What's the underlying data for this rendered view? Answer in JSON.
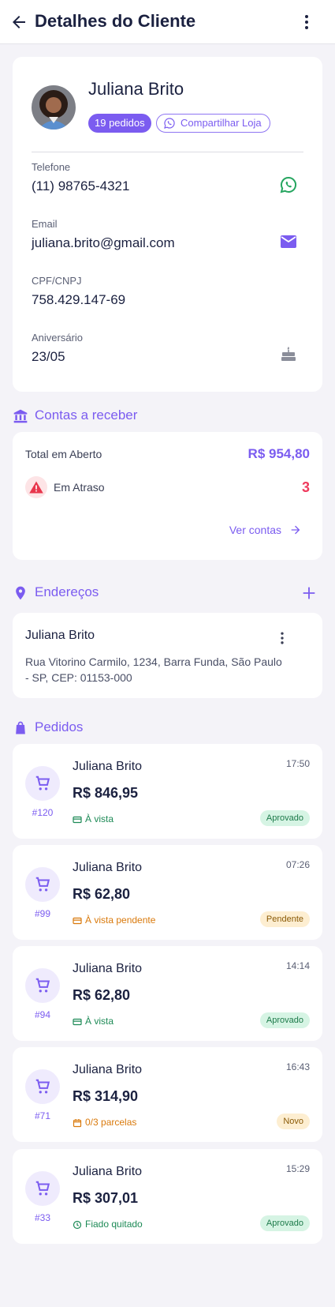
{
  "header": {
    "title": "Detalhes do Cliente",
    "back_icon": "arrow-left-icon",
    "menu_icon": "more-vertical-icon"
  },
  "profile": {
    "name": "Juliana Brito",
    "orders_badge": "19 pedidos",
    "share_label": "Compartilhar Loja",
    "phone_label": "Telefone",
    "phone_value": "(11) 98765-4321",
    "email_label": "Email",
    "email_value": "juliana.brito@gmail.com",
    "doc_label": "CPF/CNPJ",
    "doc_value": "758.429.147-69",
    "birthday_label": "Aniversário",
    "birthday_value": "23/05"
  },
  "receivables": {
    "title": "Contas a receber",
    "total_label": "Total em Aberto",
    "total_value": "R$ 954,80",
    "late_label": "Em Atraso",
    "late_count": "3",
    "link_label": "Ver contas"
  },
  "addresses": {
    "title": "Endereços",
    "items": [
      {
        "name": "Juliana Brito",
        "text": "Rua Vitorino Carmilo, 1234, Barra Funda, São Paulo - SP, CEP: 01153-000"
      }
    ]
  },
  "orders": {
    "title": "Pedidos",
    "items": [
      {
        "number": "#120",
        "name": "Juliana Brito",
        "time": "17:50",
        "total": "R$ 846,95",
        "payment": "À vista",
        "payment_icon": "credit-card-icon",
        "status": "Aprovado"
      },
      {
        "number": "#99",
        "name": "Juliana Brito",
        "time": "07:26",
        "total": "R$ 62,80",
        "payment": "À vista pendente",
        "payment_icon": "credit-card-icon",
        "status": "Pendente"
      },
      {
        "number": "#94",
        "name": "Juliana Brito",
        "time": "14:14",
        "total": "R$ 62,80",
        "payment": "À vista",
        "payment_icon": "credit-card-icon",
        "status": "Aprovado"
      },
      {
        "number": "#71",
        "name": "Juliana Brito",
        "time": "16:43",
        "total": "R$ 314,90",
        "payment": "0/3 parcelas",
        "payment_icon": "calendar-icon",
        "status": "Novo"
      },
      {
        "number": "#33",
        "name": "Juliana Brito",
        "time": "15:29",
        "total": "R$ 307,01",
        "payment": "Fiado quitado",
        "payment_icon": "clock-icon",
        "status": "Aprovado"
      }
    ]
  },
  "colors": {
    "accent": "#7b5cf0",
    "whatsapp": "#25a55f",
    "danger": "#ef3a5d",
    "approved_bg": "#d6f4e4",
    "pending_bg": "#fdeed1",
    "payment_green": "#1d8a56",
    "payment_orange": "#d9790b"
  }
}
